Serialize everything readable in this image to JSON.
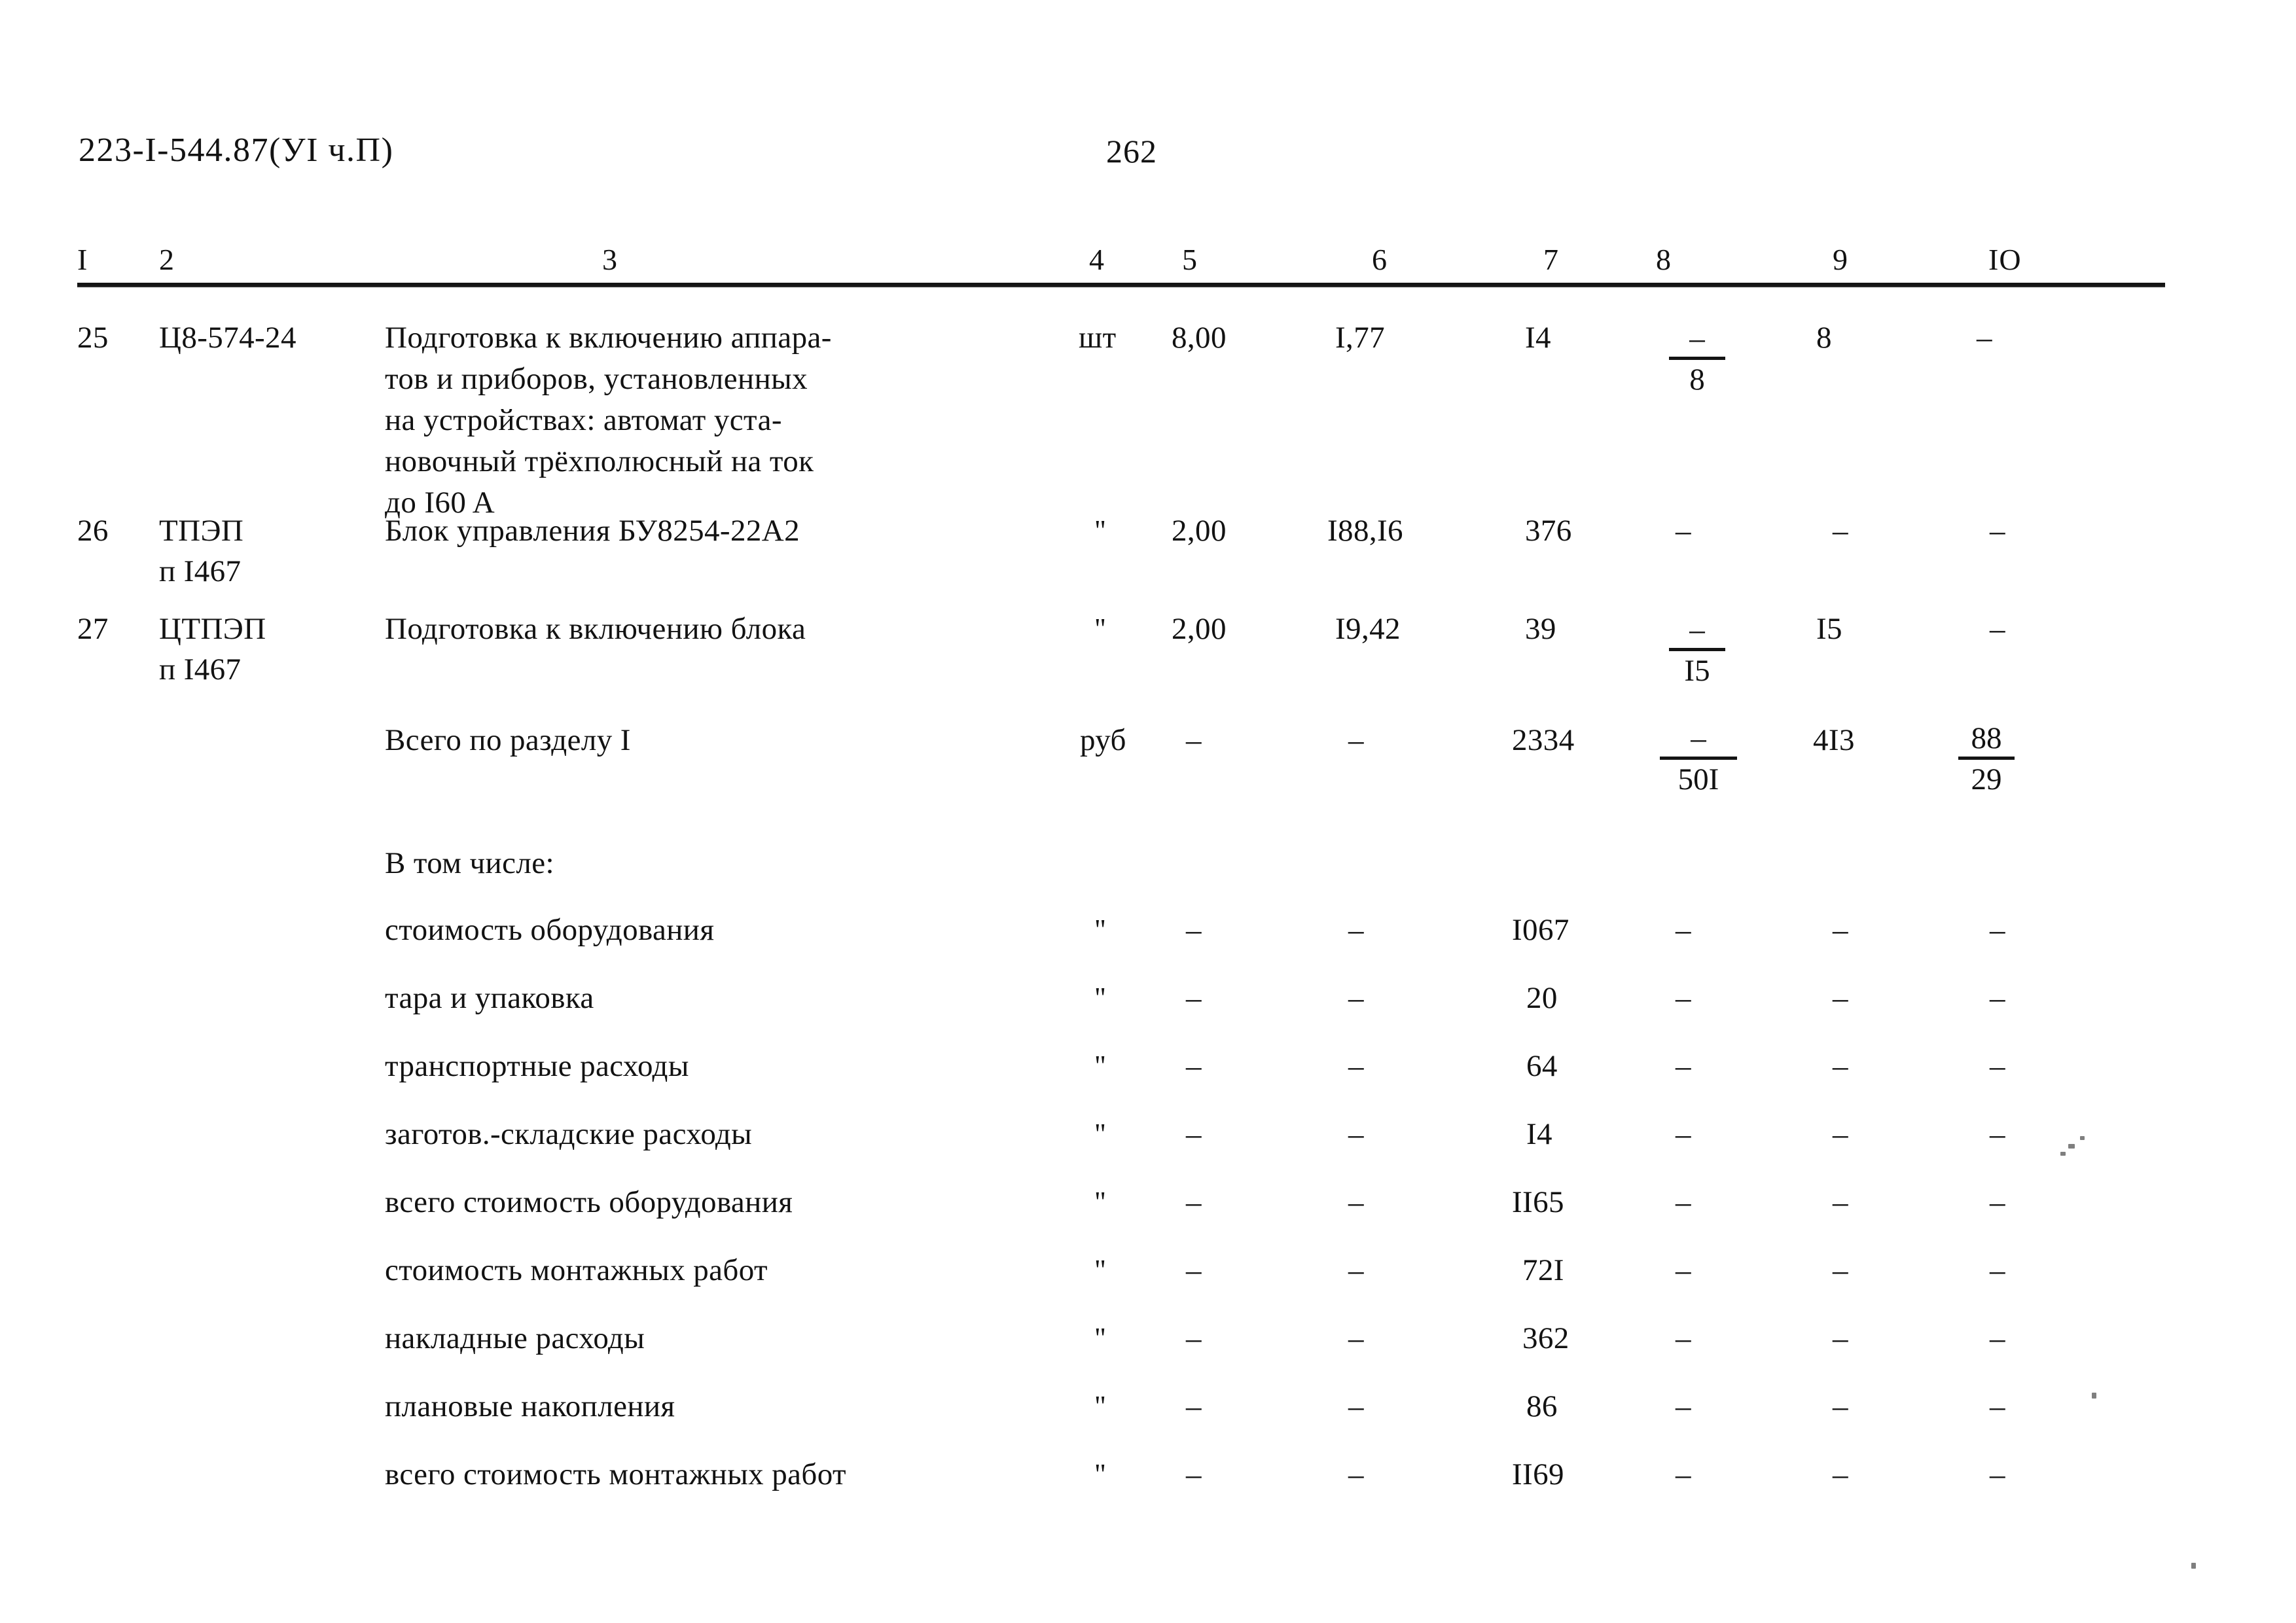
{
  "header": {
    "doc_code": "223-I-544.87(УI ч.П)",
    "page_number": "262"
  },
  "table": {
    "column_numbers": [
      "I",
      "2",
      "3",
      "4",
      "5",
      "6",
      "7",
      "8",
      "9",
      "IO"
    ],
    "rows": [
      {
        "num": "25",
        "code": "Ц8-574-24",
        "desc_lines": [
          "Подготовка к включению аппара-",
          "тов и приборов, установленных",
          "на устройствах: автомат уста-",
          "новочный трёхполюсный на ток",
          "до I60 A"
        ],
        "unit": "шт",
        "qty": "8,00",
        "price": "I,77",
        "sum": "I4",
        "col8_top": "–",
        "col8_bottom": "8",
        "col9": "8",
        "col10": "–"
      },
      {
        "num": "26",
        "code_lines": [
          "ТПЭП",
          "п I467"
        ],
        "desc_lines": [
          "Блок управления БУ8254-22А2"
        ],
        "unit": "\"",
        "qty": "2,00",
        "price": "I88,I6",
        "sum": "376",
        "col8": "–",
        "col9": "–",
        "col10": "–"
      },
      {
        "num": "27",
        "code_lines": [
          "ЦТПЭП",
          "п I467"
        ],
        "desc_lines": [
          "Подготовка к включению блока"
        ],
        "unit": "\"",
        "qty": "2,00",
        "price": "I9,42",
        "sum": "39",
        "col8_top": "–",
        "col8_bottom": "I5",
        "col9": "I5",
        "col10": "–"
      },
      {
        "num": "",
        "code": "",
        "desc_lines": [
          "Всего по разделу I"
        ],
        "unit": "руб",
        "qty": "–",
        "price": "–",
        "sum": "2334",
        "col8_top": "–",
        "col8_bottom": "50I",
        "col9": "4I3",
        "col10_top": "88",
        "col10_bottom": "29"
      }
    ],
    "subsection_label": "В том числе:",
    "subrows": [
      {
        "desc": "стоимость оборудования",
        "unit": "\"",
        "qty": "–",
        "price": "–",
        "sum": "I067",
        "col8": "–",
        "col9": "–",
        "col10": "–"
      },
      {
        "desc": "тара и упаковка",
        "unit": "\"",
        "qty": "–",
        "price": "–",
        "sum": "20",
        "col8": "–",
        "col9": "–",
        "col10": "–"
      },
      {
        "desc": "транспортные расходы",
        "unit": "\"",
        "qty": "–",
        "price": "–",
        "sum": "64",
        "col8": "–",
        "col9": "–",
        "col10": "–"
      },
      {
        "desc": "заготов.-складские расходы",
        "unit": "\"",
        "qty": "–",
        "price": "–",
        "sum": "I4",
        "col8": "–",
        "col9": "–",
        "col10": "–"
      },
      {
        "desc": "всего стоимость оборудования",
        "unit": "\"",
        "qty": "–",
        "price": "–",
        "sum": "II65",
        "col8": "–",
        "col9": "–",
        "col10": "–"
      },
      {
        "desc": "стоимость монтажных работ",
        "unit": "\"",
        "qty": "–",
        "price": "–",
        "sum": "72I",
        "col8": "–",
        "col9": "–",
        "col10": "–"
      },
      {
        "desc": "накладные расходы",
        "unit": "\"",
        "qty": "–",
        "price": "–",
        "sum": "362",
        "col8": "–",
        "col9": "–",
        "col10": "–"
      },
      {
        "desc": "плановые накопления",
        "unit": "\"",
        "qty": "–",
        "price": "–",
        "sum": "86",
        "col8": "–",
        "col9": "–",
        "col10": "–"
      },
      {
        "desc": "всего стоимость монтажных работ",
        "unit": "\"",
        "qty": "–",
        "price": "–",
        "sum": "II69",
        "col8": "–",
        "col9": "–",
        "col10": "–"
      }
    ]
  }
}
